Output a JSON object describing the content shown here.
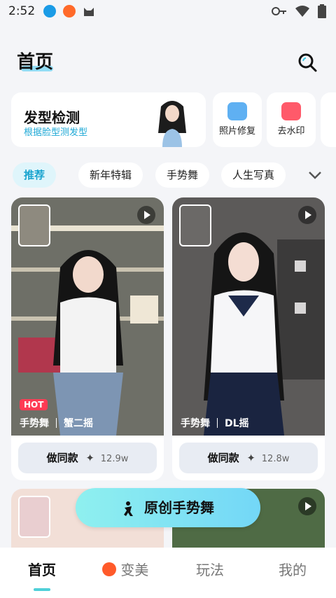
{
  "status_bar": {
    "time": "2:52",
    "left_icons": [
      "download-icon",
      "app-badge-icon",
      "cat-icon"
    ],
    "right_icons": [
      "key-icon",
      "wifi-icon",
      "battery-icon"
    ]
  },
  "header": {
    "title": "首页",
    "search_icon": "search-icon"
  },
  "tools": {
    "main": {
      "title": "发型检测",
      "subtitle": "根据脸型测发型"
    },
    "items": [
      {
        "label": "照片修复",
        "icon": "hd-photo-icon",
        "color": "#5fb0f2"
      },
      {
        "label": "去水印",
        "icon": "watermark-remove-icon",
        "color": "#ff5a6a"
      }
    ]
  },
  "tabs": [
    "推荐",
    "新年特辑",
    "手势舞",
    "人生写真"
  ],
  "feed": [
    {
      "hot": "HOT",
      "tags": [
        "手势舞",
        "蟹二摇"
      ],
      "button": "做同款",
      "count": "12.9w"
    },
    {
      "tags": [
        "手势舞",
        "DL摇"
      ],
      "button": "做同款",
      "count": "12.8w"
    }
  ],
  "floating_action": {
    "label": "原创手势舞",
    "icon": "ai-dance-icon"
  },
  "bottom_nav": [
    {
      "label": "首页",
      "active": true
    },
    {
      "label": "变美",
      "icon": "flame-icon"
    },
    {
      "label": "玩法"
    },
    {
      "label": "我的"
    }
  ],
  "colors": {
    "accent": "#1aa4cf",
    "hot": "#ff3b54",
    "fab": "#7fe3f3"
  }
}
